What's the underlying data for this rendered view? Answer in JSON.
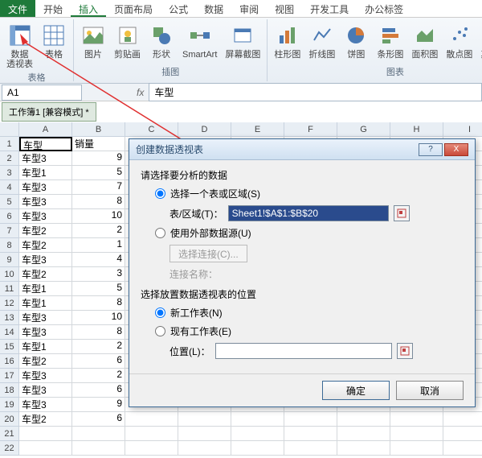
{
  "tabs": {
    "file": "文件",
    "home": "开始",
    "insert": "插入",
    "pagelayout": "页面布局",
    "formulas": "公式",
    "data": "数据",
    "review": "审阅",
    "view": "视图",
    "dev": "开发工具",
    "office": "办公标签"
  },
  "ribbon": {
    "pivot": "数据\n透视表",
    "table": "表格",
    "group_tables": "表格",
    "picture": "图片",
    "clipart": "剪贴画",
    "shapes": "形状",
    "smartart": "SmartArt",
    "screenshot": "屏幕截图",
    "group_illus": "插图",
    "column": "柱形图",
    "line": "折线图",
    "pie": "饼图",
    "bar": "条形图",
    "area": "面积图",
    "scatter": "散点图",
    "other": "其他图表",
    "group_charts": "图表"
  },
  "namebox": "A1",
  "formula": "车型",
  "workbook_tab": "工作簿1  [兼容模式] *",
  "cols": [
    "A",
    "B",
    "C",
    "D",
    "E",
    "F",
    "G",
    "H",
    "I"
  ],
  "rows": [
    {
      "n": 1,
      "a": "车型",
      "b": "销量"
    },
    {
      "n": 2,
      "a": "车型3",
      "b": "9"
    },
    {
      "n": 3,
      "a": "车型1",
      "b": "5"
    },
    {
      "n": 4,
      "a": "车型3",
      "b": "7"
    },
    {
      "n": 5,
      "a": "车型3",
      "b": "8"
    },
    {
      "n": 6,
      "a": "车型3",
      "b": "10"
    },
    {
      "n": 7,
      "a": "车型2",
      "b": "2"
    },
    {
      "n": 8,
      "a": "车型2",
      "b": "1"
    },
    {
      "n": 9,
      "a": "车型3",
      "b": "4"
    },
    {
      "n": 10,
      "a": "车型2",
      "b": "3"
    },
    {
      "n": 11,
      "a": "车型1",
      "b": "5"
    },
    {
      "n": 12,
      "a": "车型1",
      "b": "8"
    },
    {
      "n": 13,
      "a": "车型3",
      "b": "10"
    },
    {
      "n": 14,
      "a": "车型3",
      "b": "8"
    },
    {
      "n": 15,
      "a": "车型1",
      "b": "2"
    },
    {
      "n": 16,
      "a": "车型2",
      "b": "6"
    },
    {
      "n": 17,
      "a": "车型3",
      "b": "2"
    },
    {
      "n": 18,
      "a": "车型3",
      "b": "6"
    },
    {
      "n": 19,
      "a": "车型3",
      "b": "9"
    },
    {
      "n": 20,
      "a": "车型2",
      "b": "6"
    },
    {
      "n": 21,
      "a": "",
      "b": ""
    },
    {
      "n": 22,
      "a": "",
      "b": ""
    }
  ],
  "dialog": {
    "title": "创建数据透视表",
    "section1": "请选择要分析的数据",
    "opt_range": "选择一个表或区域(S)",
    "range_label": "表/区域(T)：",
    "range_value": "Sheet1!$A$1:$B$20",
    "opt_external": "使用外部数据源(U)",
    "choose_conn": "选择连接(C)...",
    "conn_name_label": "连接名称：",
    "section2": "选择放置数据透视表的位置",
    "opt_newsheet": "新工作表(N)",
    "opt_existing": "现有工作表(E)",
    "loc_label": "位置(L)：",
    "ok": "确定",
    "cancel": "取消",
    "help": "?",
    "close": "X"
  }
}
